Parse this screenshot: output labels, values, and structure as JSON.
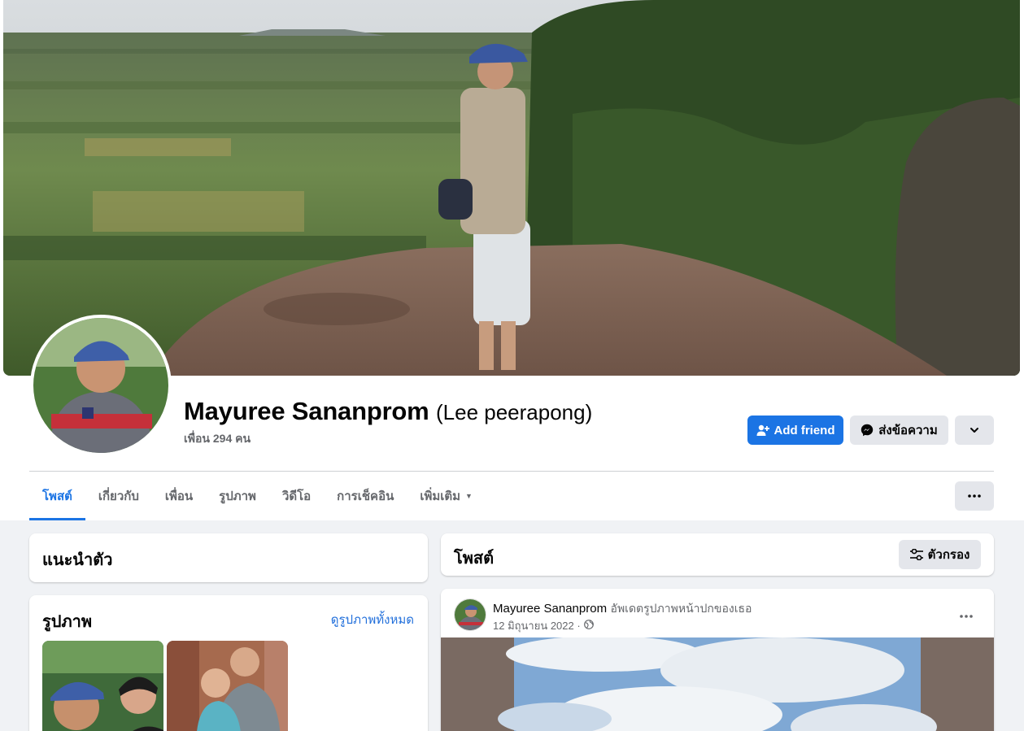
{
  "profile": {
    "name": "Mayuree Sananprom",
    "alt_name": "(Lee peerapong)",
    "friend_count": "เพื่อน 294 คน"
  },
  "actions": {
    "add_friend": "Add friend",
    "message": "ส่งข้อความ"
  },
  "tabs": [
    {
      "label": "โพสต์"
    },
    {
      "label": "เกี่ยวกับ"
    },
    {
      "label": "เพื่อน"
    },
    {
      "label": "รูปภาพ"
    },
    {
      "label": "วิดีโอ"
    },
    {
      "label": "การเช็คอิน"
    },
    {
      "label": "เพิ่มเติม"
    }
  ],
  "intro": {
    "title": "แนะนำตัว"
  },
  "photos": {
    "title": "รูปภาพ",
    "see_all": "ดูรูปภาพทั้งหมด"
  },
  "posts": {
    "title": "โพสต์",
    "filter_label": "ตัวกรอง",
    "items": [
      {
        "author": "Mayuree Sananprom",
        "action": "อัพเดตรูปภาพหน้าปกของเธอ",
        "time": "12 มิถุนายน 2022 ·",
        "privacy_icon": "globe-icon"
      }
    ]
  },
  "colors": {
    "accent": "#1b74e4",
    "secondary_button": "#e4e6eb",
    "background": "#f0f2f5"
  }
}
